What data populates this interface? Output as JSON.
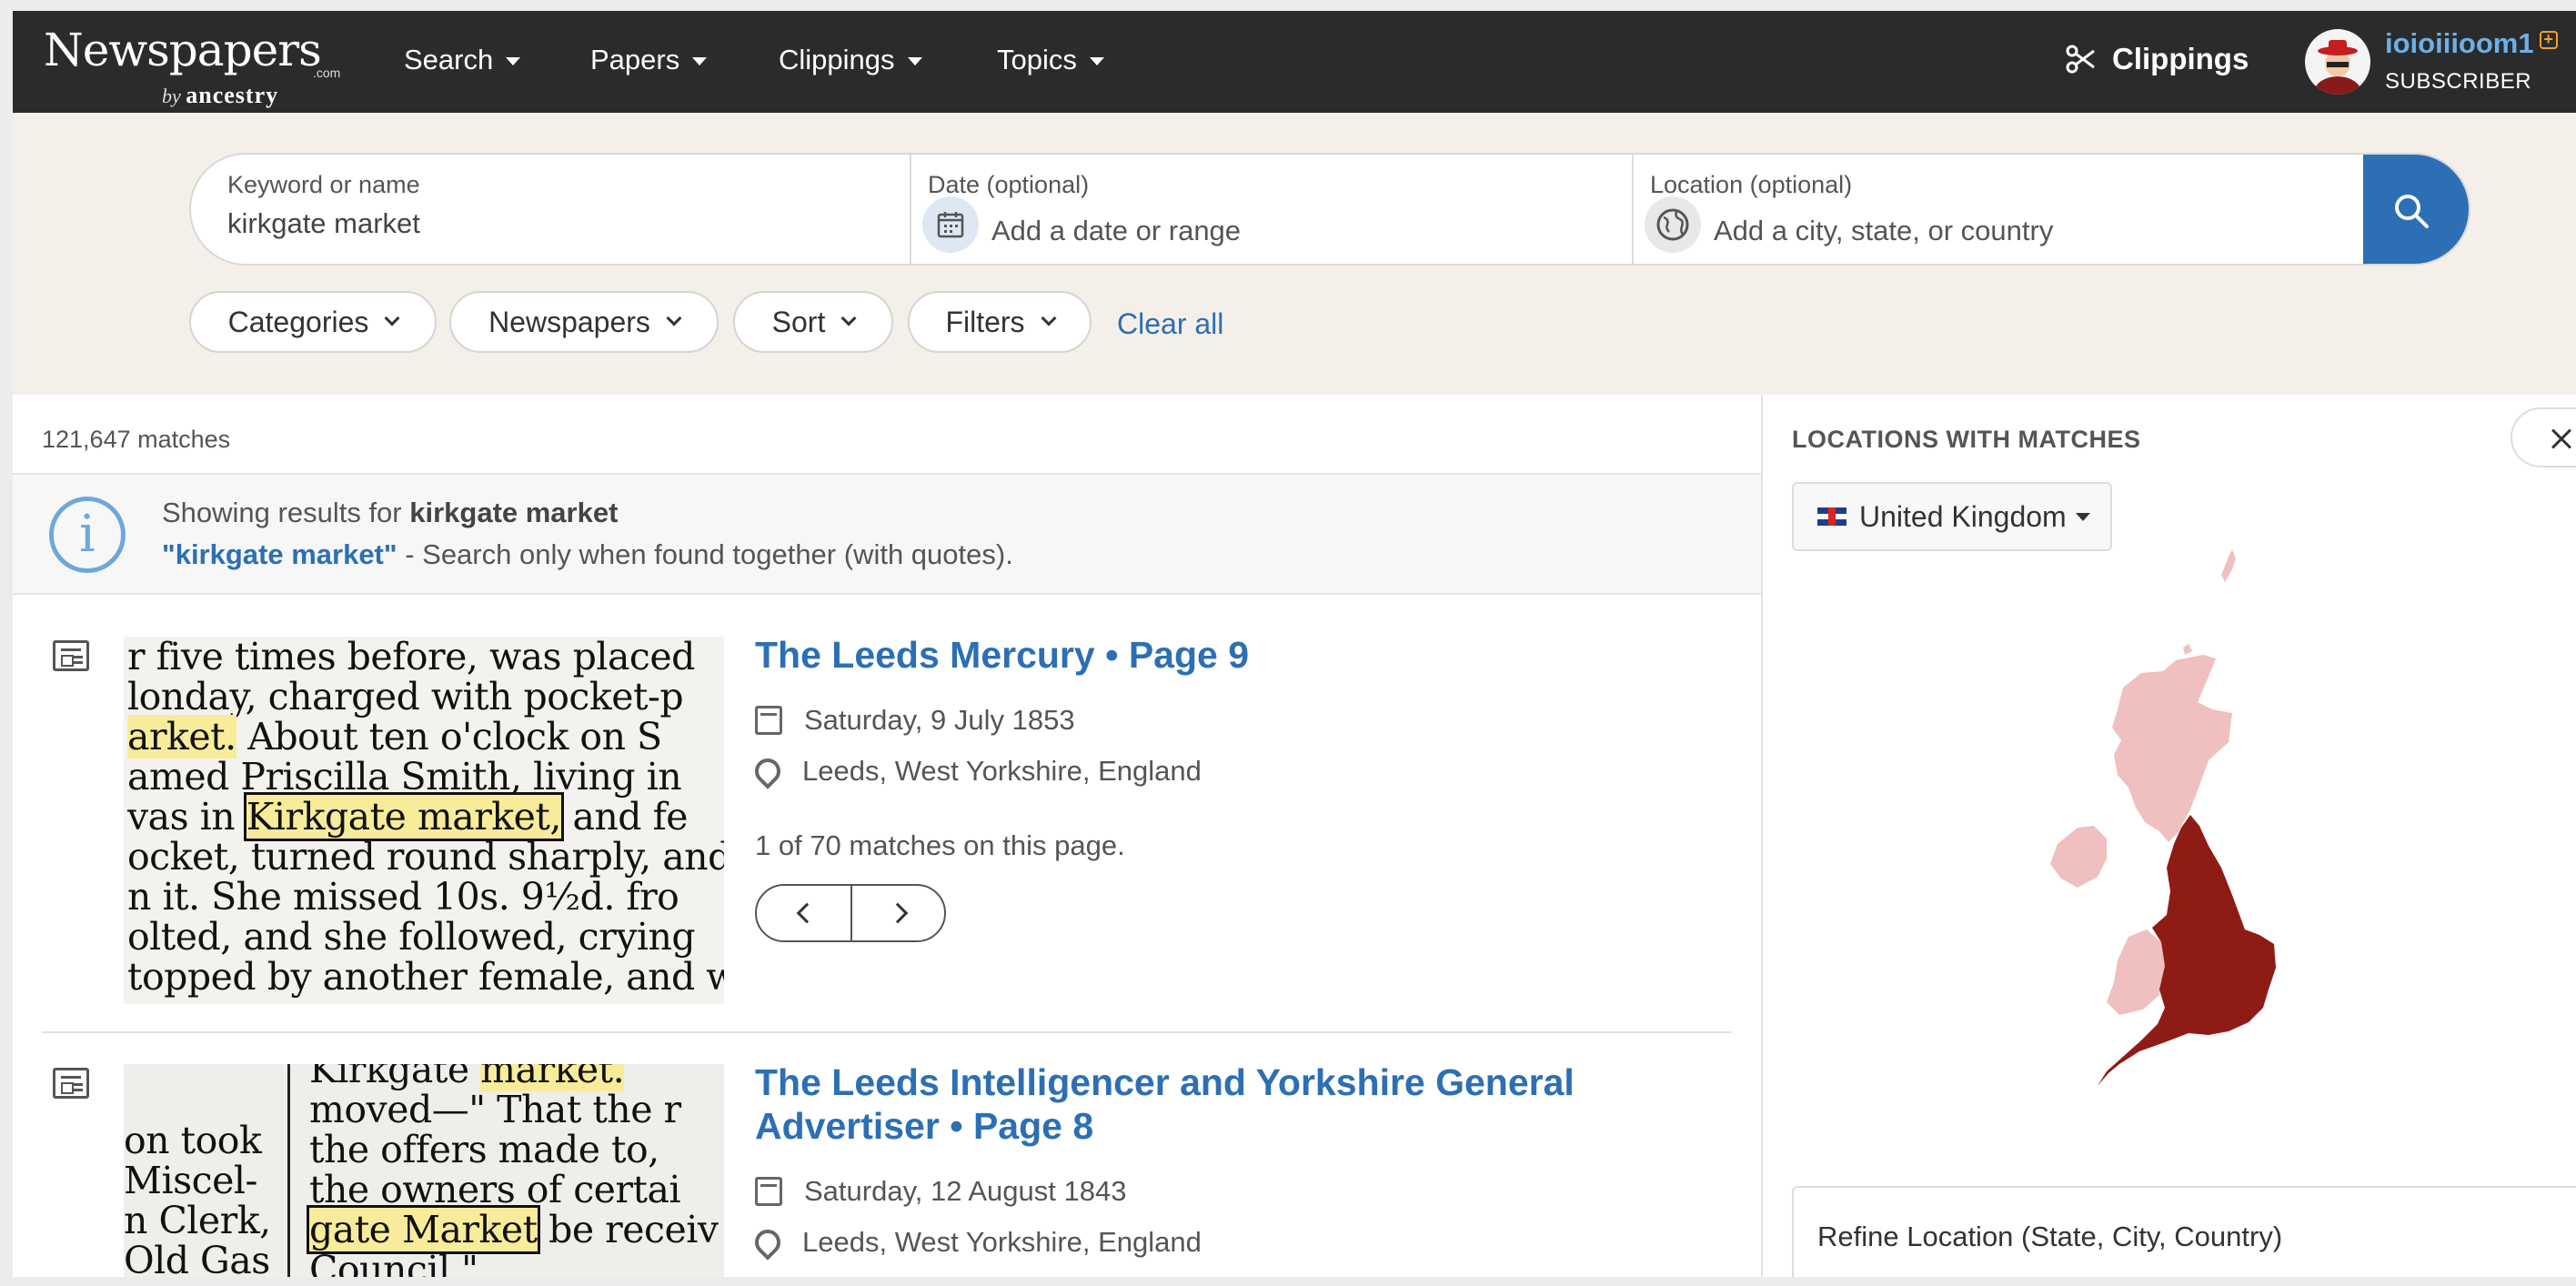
{
  "brand": {
    "word": "Newspapers",
    "com": ".com",
    "by": "by",
    "ancestry": "ancestry"
  },
  "nav": {
    "items": [
      {
        "label": "Search"
      },
      {
        "label": "Papers"
      },
      {
        "label": "Clippings"
      },
      {
        "label": "Topics"
      }
    ],
    "clippings_link": "Clippings",
    "user": {
      "name": "ioioiiioom1",
      "role": "SUBSCRIBER"
    }
  },
  "search": {
    "keyword": {
      "label": "Keyword or name",
      "value": "kirkgate market"
    },
    "date": {
      "label": "Date (optional)",
      "placeholder": "Add a date or range"
    },
    "location": {
      "label": "Location (optional)",
      "placeholder": "Add a city, state, or country"
    }
  },
  "filters": {
    "pills": [
      "Categories",
      "Newspapers",
      "Sort",
      "Filters"
    ],
    "clear_all": "Clear all"
  },
  "results": {
    "count": "121,647 matches",
    "info": {
      "showing_prefix": "Showing results for ",
      "query": "kirkgate market",
      "quoted_link": "\"kirkgate market\"",
      "quoted_suffix": " - Search only when found together (with quotes)."
    },
    "items": [
      {
        "title": "The Leeds Mercury • Page 9",
        "date": "Saturday, 9 July 1853",
        "location": "Leeds, West Yorkshire, England",
        "match_info": "1 of 70 matches on this page.",
        "snippet": {
          "l1": "r five times before, was placed",
          "l2": "londay, charged with pocket-p",
          "l3a": "arket.",
          "l3b": " About ten o'clock on S",
          "l4": "amed Priscilla Smith, living in",
          "l5a": "vas in ",
          "l5b": "Kirkgate market,",
          "l5c": " and fe",
          "l6": "ocket, turned round sharply, and",
          "l7": "n it.  She missed 10s. 9½d. fro",
          "l8": "olted, and she followed, crying",
          "l9": "topped by another female, and wl"
        }
      },
      {
        "title": "The Leeds Intelligencer and Yorkshire General Advertiser • Page 8",
        "date": "Saturday, 12 August 1843",
        "location": "Leeds, West Yorkshire, England",
        "snippet": {
          "l1a": "Kirkgate ",
          "l1b": "market.",
          "l2": "moved—\" That the r",
          "l3": "the offers made to,",
          "l4": "the owners of certai",
          "l5a": "gate Market",
          "l5b": " be receiv",
          "l6": "Council.\"",
          "c1": "on took",
          "c2": "Miscel-",
          "c3": "n Clerk,",
          "c4": "Old Gas"
        }
      }
    ]
  },
  "side_panel": {
    "title": "LOCATIONS WITH MATCHES",
    "country": "United Kingdom",
    "refine_label": "Refine Location (State, City, Country)"
  },
  "colors": {
    "nav_bg": "#2b2b2b",
    "accent": "#2c6fb4",
    "band_bg": "#f4f0e9",
    "map_england": "#8f1c14",
    "map_other": "#f0bfc0"
  }
}
